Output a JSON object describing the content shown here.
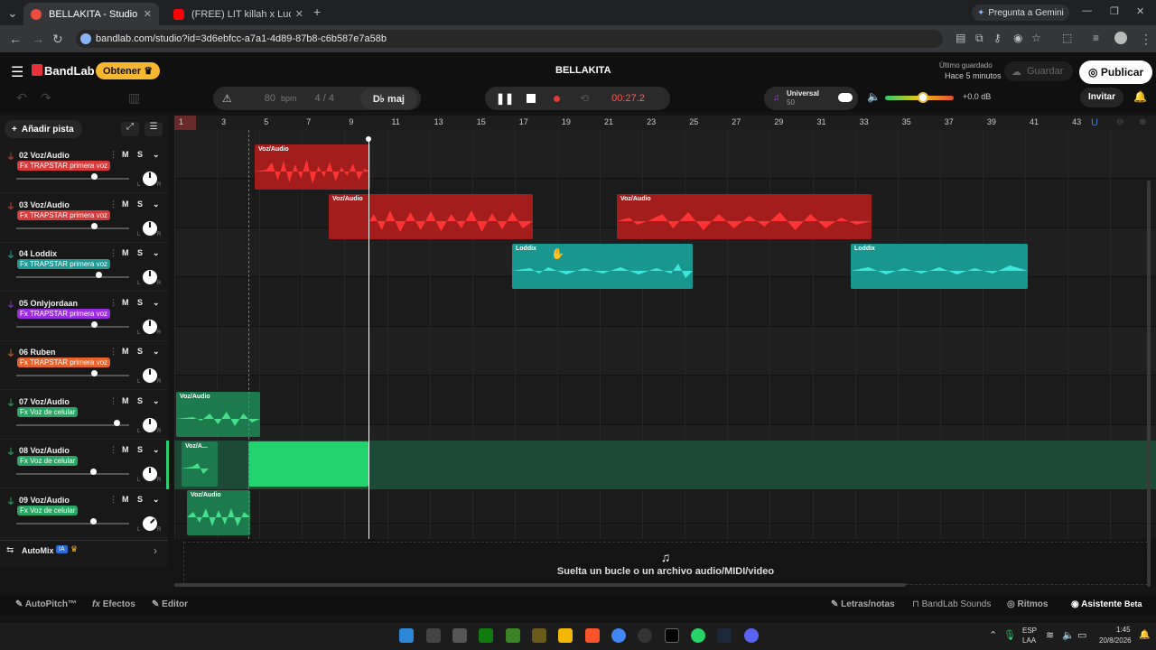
{
  "browser": {
    "tabs": [
      {
        "title": "BELLAKITA - Studio",
        "active": true
      },
      {
        "title": "(FREE) LIT killah x Lucho SSJ Typ",
        "active": false
      }
    ],
    "new_tab": "+",
    "gemini": "Pregunta a Gemini",
    "url": "bandlab.com/studio?id=3d6ebfcc-a7a1-4d89-87b8-c6b587e7a58b"
  },
  "app": {
    "logo": "BandLab",
    "obtener": "Obtener",
    "project_title": "BELLAKITA",
    "saved_label": "Último guardado",
    "saved_time": "Hace 5 minutos",
    "save_btn": "Guardar",
    "publish_btn": "Publicar",
    "bpm_value": "80",
    "bpm_label": "bpm",
    "time_sig": "4 / 4",
    "key": "D♭ maj",
    "time": "00:27.2",
    "preset_name": "Universal",
    "preset_val": "50",
    "master_db": "+0.0 dB",
    "invite": "Invitar",
    "add_track": "Añadir pista",
    "automix": "AutoMix",
    "automix_badge": "IA"
  },
  "tracks": [
    {
      "name": "02 Voz/Audio",
      "fx": "Fx TRAPSTAR primera voz",
      "fx_color": "#d63a3a",
      "mic": "#e74c3c"
    },
    {
      "name": "03 Voz/Audio",
      "fx": "Fx TRAPSTAR primera voz",
      "fx_color": "#d63a3a",
      "mic": "#e74c3c"
    },
    {
      "name": "04 Loddix",
      "fx": "Fx TRAPSTAR primera voz",
      "fx_color": "#1f9a95",
      "mic": "#24c1b5"
    },
    {
      "name": "05 Onlyjordaan",
      "fx": "Fx TRAPSTAR primera voz",
      "fx_color": "#9b2de0",
      "mic": "#a33de8"
    },
    {
      "name": "06 Ruben",
      "fx": "Fx TRAPSTAR primera voz",
      "fx_color": "#e6622c",
      "mic": "#f07a2a"
    },
    {
      "name": "07 Voz/Audio",
      "fx": "Fx Voz de celular",
      "fx_color": "#2aa664",
      "mic": "#2ecc71"
    },
    {
      "name": "08 Voz/Audio",
      "fx": "Fx Voz de celular",
      "fx_color": "#2aa664",
      "mic": "#2ecc71"
    },
    {
      "name": "09 Voz/Audio",
      "fx": "Fx Voz de celular",
      "fx_color": "#2aa664",
      "mic": "#2ecc71"
    }
  ],
  "ms": {
    "m": "M",
    "s": "S"
  },
  "lr": {
    "l": "L",
    "r": "R"
  },
  "ruler": [
    "1",
    "3",
    "5",
    "7",
    "9",
    "11",
    "13",
    "15",
    "17",
    "19",
    "21",
    "23",
    "25",
    "27",
    "29",
    "31",
    "33",
    "35",
    "37",
    "39",
    "41",
    "43"
  ],
  "clips": {
    "voz": "Voz/Audio",
    "voz_short": "Voz/A...",
    "loddix": "Loddix"
  },
  "drop_text": "Suelta un bucle o un archivo audio/MIDI/video",
  "bottom": {
    "autopitch": "AutoPitch™",
    "efectos": "Efectos",
    "editor": "Editor",
    "letras": "Letras/notas",
    "sounds": "BandLab Sounds",
    "ritmos": "Ritmos",
    "asistente": "Asistente",
    "beta": "Beta"
  },
  "taskbar": {
    "lang1": "ESP",
    "lang2": "LAA",
    "time": "1:45",
    "date": "20/8/2026"
  }
}
